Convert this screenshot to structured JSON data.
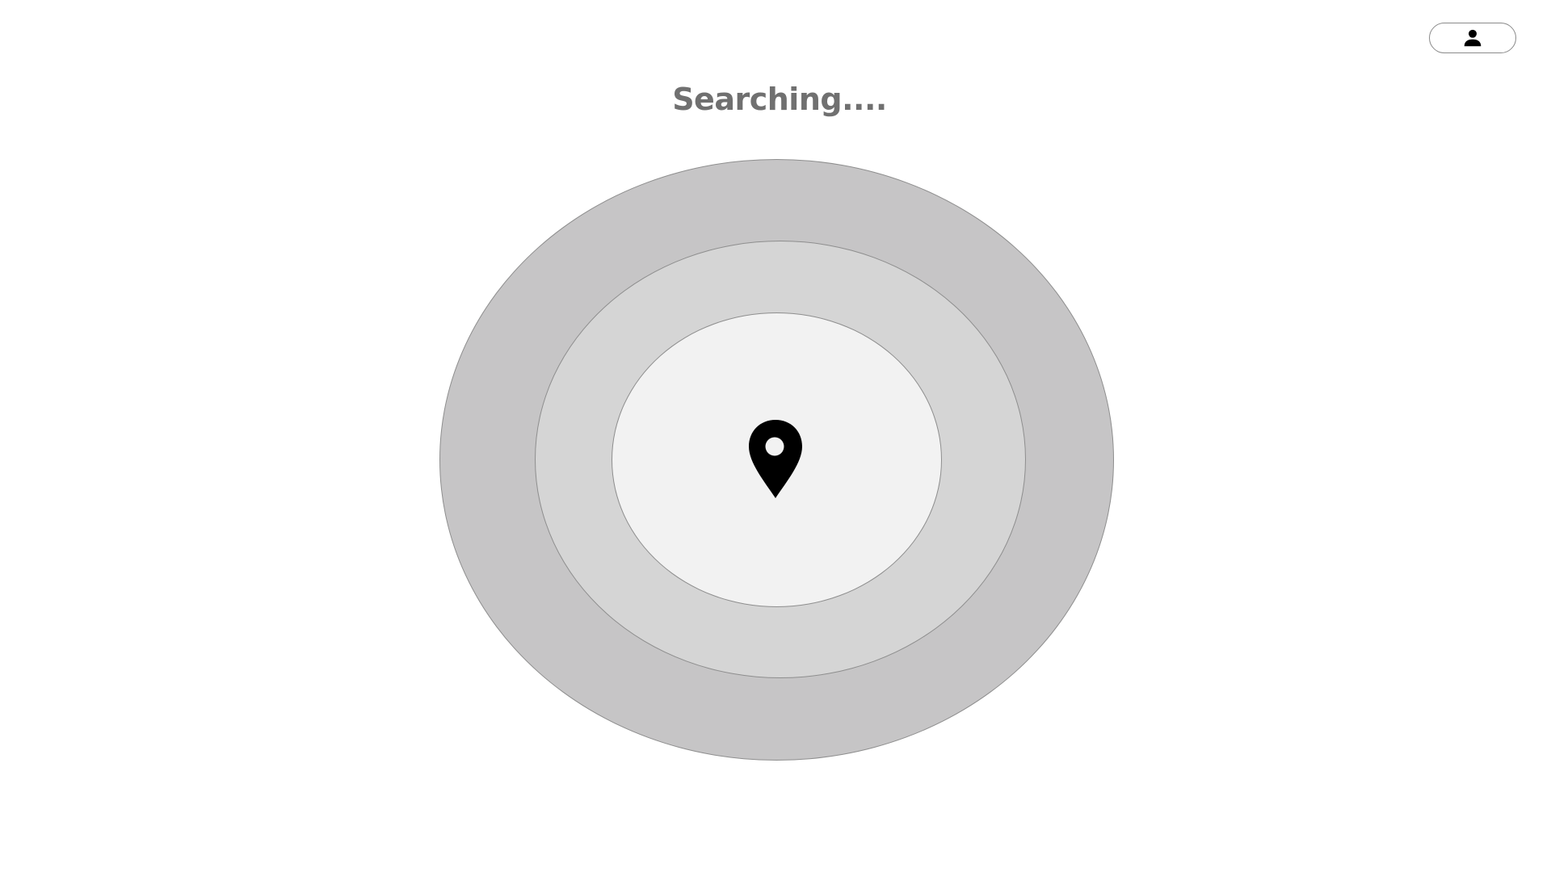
{
  "header": {
    "title": "Searching...."
  },
  "profile_button": {
    "icon": "person-icon"
  },
  "radar": {
    "icon": "location-pin-icon",
    "colors": {
      "outer": "#c6c5c6",
      "middle": "#d5d5d5",
      "inner": "#f2f2f2",
      "pin": "#000000",
      "title": "#707070"
    }
  }
}
